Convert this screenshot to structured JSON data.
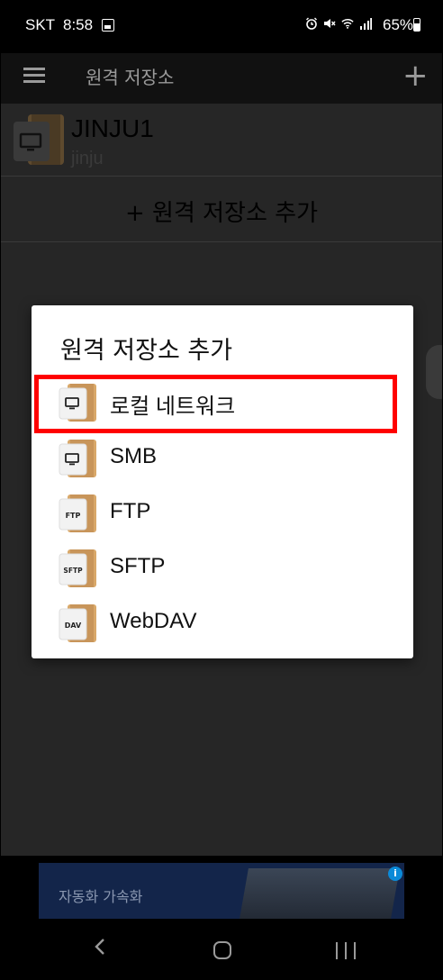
{
  "status_bar": {
    "carrier": "SKT",
    "time": "8:58",
    "battery": "65%",
    "icons": [
      "image-icon",
      "alarm-icon",
      "mute-icon",
      "wifi-icon",
      "signal-icon",
      "battery-icon"
    ]
  },
  "app_bar": {
    "title": "원격 저장소",
    "menu_icon": "menu-icon",
    "add_icon": "plus-icon"
  },
  "storage_list": {
    "items": [
      {
        "name": "JINJU1",
        "subtitle": "jinju",
        "icon": "monitor-folder-icon"
      }
    ],
    "add_label": "+ 원격 저장소 추가"
  },
  "dialog": {
    "title": "원격 저장소 추가",
    "options": [
      {
        "label": "로컬 네트워크",
        "icon": "monitor-folder-icon",
        "badge": "",
        "highlighted": true
      },
      {
        "label": "SMB",
        "icon": "monitor-folder-icon",
        "badge": "",
        "highlighted": false
      },
      {
        "label": "FTP",
        "icon": "ftp-folder-icon",
        "badge": "FTP",
        "highlighted": false
      },
      {
        "label": "SFTP",
        "icon": "sftp-folder-icon",
        "badge": "SFTP",
        "highlighted": false
      },
      {
        "label": "WebDAV",
        "icon": "webdav-folder-icon",
        "badge": "DAV",
        "highlighted": false
      }
    ]
  },
  "ad": {
    "text": "자동화 가속화"
  },
  "colors": {
    "highlight": "#ff0000",
    "folder": "#d9a869",
    "overlay": "#262626"
  }
}
